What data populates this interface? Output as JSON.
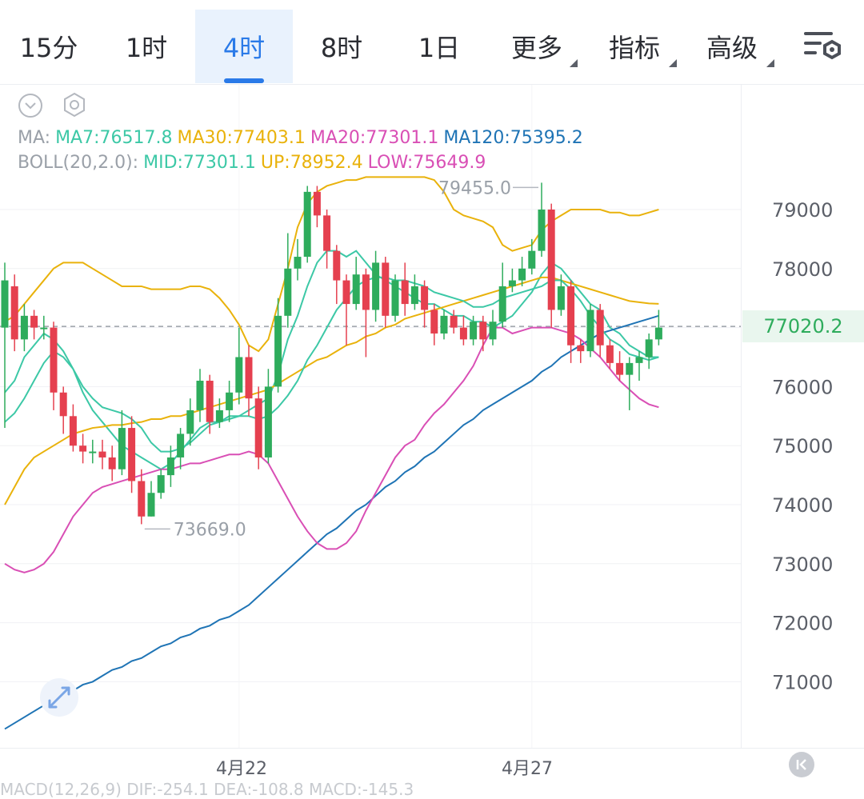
{
  "tabs": [
    {
      "label": "15分",
      "active": false
    },
    {
      "label": "1时",
      "active": false
    },
    {
      "label": "4时",
      "active": true
    },
    {
      "label": "8时",
      "active": false
    },
    {
      "label": "1日",
      "active": false
    },
    {
      "label": "更多",
      "active": false,
      "dropdown": true
    },
    {
      "label": "指标",
      "active": false,
      "dropdown": true
    },
    {
      "label": "高级",
      "active": false,
      "dropdown": true
    }
  ],
  "icons": {
    "settings": "list-settings-icon",
    "collapse": "chevron-down-circle-icon",
    "hexagon": "hexagon-settings-icon",
    "expand": "expand-arrows-icon",
    "go_latest": "skip-to-latest-icon"
  },
  "legend_ma": {
    "prefix": "MA:",
    "items": [
      {
        "text": "MA7:76517.8",
        "color": "#3cc8a6"
      },
      {
        "text": "MA30:77403.1",
        "color": "#e9b20b"
      },
      {
        "text": "MA20:77301.1",
        "color": "#d94fb5"
      },
      {
        "text": "MA120:75395.2",
        "color": "#1f74b5"
      }
    ]
  },
  "legend_boll": {
    "prefix": "BOLL(20,2.0):",
    "items": [
      {
        "text": "MID:77301.1",
        "color": "#3cc8a6"
      },
      {
        "text": "UP:78952.4",
        "color": "#e9b20b"
      },
      {
        "text": "LOW:75649.9",
        "color": "#d94fb5"
      }
    ]
  },
  "current_price": "77020.2",
  "bottom_peek": "MACD(12,26,9) DIF:-254.1 DEA:-108.8 MACD:-145.3",
  "colors": {
    "up": "#2eac5c",
    "down": "#e5404f",
    "accent": "#2a7ae8"
  },
  "chart_data": {
    "type": "candlestick",
    "y_ticks": [
      79000,
      78000,
      77000,
      76000,
      75000,
      74000,
      73000,
      72000,
      71000
    ],
    "y_tick_labels": [
      "79000",
      "78000",
      "",
      "76000",
      "75000",
      "74000",
      "73000",
      "72000",
      "71000"
    ],
    "x_labels": [
      {
        "label": "4月22",
        "index": 24
      },
      {
        "label": "4月27",
        "index": 54
      }
    ],
    "high_marker": {
      "label": "79455.0",
      "value": 79455.0,
      "index": 55
    },
    "low_marker": {
      "label": "73669.0",
      "value": 73669.0,
      "index": 14
    },
    "current": 77020.2,
    "candles": [
      [
        77000,
        77800,
        78100,
        75300
      ],
      [
        77700,
        76800,
        77900,
        76600
      ],
      [
        76800,
        77200,
        77400,
        76600
      ],
      [
        77200,
        77000,
        77300,
        76800
      ],
      [
        77000,
        77000,
        77200,
        76800
      ],
      [
        77000,
        75900,
        77100,
        75600
      ],
      [
        75900,
        75500,
        76000,
        75200
      ],
      [
        75500,
        75000,
        75700,
        74900
      ],
      [
        75000,
        74900,
        75200,
        74700
      ],
      [
        74900,
        74900,
        75100,
        74700
      ],
      [
        74900,
        74800,
        75100,
        74600
      ],
      [
        74800,
        74600,
        75000,
        74400
      ],
      [
        74600,
        75300,
        75600,
        74500
      ],
      [
        75300,
        74400,
        75500,
        74200
      ],
      [
        74400,
        73800,
        74600,
        73669
      ],
      [
        73800,
        74200,
        74400,
        73800
      ],
      [
        74200,
        74500,
        74600,
        74100
      ],
      [
        74500,
        74800,
        75000,
        74300
      ],
      [
        74800,
        75200,
        75300,
        74600
      ],
      [
        75200,
        75600,
        75800,
        75000
      ],
      [
        75600,
        76100,
        76300,
        75400
      ],
      [
        76100,
        75400,
        76200,
        75200
      ],
      [
        75400,
        75600,
        75800,
        75300
      ],
      [
        75600,
        75900,
        76100,
        75400
      ],
      [
        75900,
        76500,
        77000,
        75700
      ],
      [
        76500,
        75800,
        76700,
        75500
      ],
      [
        75800,
        74800,
        76000,
        74600
      ],
      [
        74800,
        76000,
        76300,
        74700
      ],
      [
        76000,
        77200,
        77500,
        75900
      ],
      [
        77200,
        78000,
        78600,
        77000
      ],
      [
        78000,
        78200,
        78500,
        77800
      ],
      [
        78200,
        79300,
        79400,
        78100
      ],
      [
        79300,
        78900,
        79400,
        78700
      ],
      [
        78900,
        78300,
        79000,
        78000
      ],
      [
        78300,
        77800,
        78400,
        77400
      ],
      [
        77800,
        77400,
        77900,
        76700
      ],
      [
        77400,
        77900,
        78200,
        77300
      ],
      [
        77900,
        77300,
        78000,
        76500
      ],
      [
        77300,
        78100,
        78300,
        77100
      ],
      [
        78100,
        77200,
        78200,
        77000
      ],
      [
        77200,
        77800,
        77900,
        77100
      ],
      [
        77800,
        77400,
        78100,
        77200
      ],
      [
        77400,
        77700,
        77900,
        77300
      ],
      [
        77700,
        77300,
        77800,
        77000
      ],
      [
        77300,
        76900,
        77400,
        76700
      ],
      [
        76900,
        77200,
        77300,
        76800
      ],
      [
        77200,
        77000,
        77300,
        76900
      ],
      [
        77000,
        76800,
        77200,
        76700
      ],
      [
        76800,
        77100,
        77200,
        76700
      ],
      [
        77100,
        76800,
        77200,
        76600
      ],
      [
        76800,
        77100,
        77300,
        76700
      ],
      [
        77100,
        77700,
        78100,
        77000
      ],
      [
        77700,
        77800,
        78000,
        77600
      ],
      [
        77800,
        78000,
        78200,
        77700
      ],
      [
        78000,
        78300,
        78500,
        77900
      ],
      [
        78300,
        79000,
        79455,
        78200
      ],
      [
        79000,
        77300,
        79100,
        77000
      ],
      [
        77300,
        77700,
        77900,
        77200
      ],
      [
        77700,
        76700,
        77800,
        76400
      ],
      [
        76700,
        76600,
        76800,
        76400
      ],
      [
        76600,
        77300,
        77400,
        76500
      ],
      [
        77300,
        76700,
        77400,
        76500
      ],
      [
        76700,
        76400,
        76800,
        76300
      ],
      [
        76400,
        76200,
        76600,
        76100
      ],
      [
        76200,
        76400,
        76500,
        75600
      ],
      [
        76400,
        76500,
        76600,
        76100
      ],
      [
        76500,
        76800,
        76900,
        76300
      ],
      [
        76800,
        77000,
        77300,
        76700
      ]
    ],
    "series": [
      {
        "name": "MA7",
        "color": "#3cc8a6",
        "values": [
          75900,
          76100,
          76500,
          76700,
          76900,
          76800,
          76600,
          76300,
          75900,
          75600,
          75400,
          75200,
          75000,
          74900,
          74800,
          74700,
          74600,
          74700,
          74900,
          75100,
          75300,
          75400,
          75400,
          75500,
          75500,
          75600,
          75700,
          75800,
          76200,
          76800,
          77200,
          77700,
          78100,
          78300,
          78300,
          78200,
          78300,
          78100,
          77900,
          77800,
          77700,
          77600,
          77500,
          77400,
          77400,
          77300,
          77200,
          77200,
          77100,
          77100,
          77000,
          77100,
          77200,
          77400,
          77600,
          77900,
          78100,
          78000,
          77800,
          77600,
          77400,
          77300,
          77000,
          76900,
          76700,
          76600,
          76500,
          76500
        ]
      },
      {
        "name": "MA30",
        "color": "#e9b20b",
        "values": [
          74000,
          74300,
          74600,
          74800,
          74900,
          75000,
          75100,
          75200,
          75250,
          75300,
          75320,
          75350,
          75350,
          75380,
          75400,
          75450,
          75450,
          75500,
          75500,
          75550,
          75600,
          75650,
          75700,
          75750,
          75800,
          75850,
          75900,
          75950,
          76050,
          76150,
          76250,
          76350,
          76450,
          76500,
          76600,
          76700,
          76750,
          76850,
          76900,
          77000,
          77050,
          77150,
          77200,
          77250,
          77300,
          77350,
          77400,
          77450,
          77500,
          77550,
          77600,
          77650,
          77700,
          77750,
          77800,
          77850,
          77850,
          77800,
          77750,
          77700,
          77650,
          77600,
          77550,
          77500,
          77450,
          77430,
          77410,
          77403
        ]
      },
      {
        "name": "MA120",
        "color": "#1f74b5",
        "values": [
          70200,
          70300,
          70400,
          70500,
          70600,
          70700,
          70750,
          70850,
          70950,
          71000,
          71100,
          71200,
          71250,
          71350,
          71400,
          71500,
          71600,
          71650,
          71750,
          71800,
          71900,
          71950,
          72050,
          72100,
          72200,
          72300,
          72450,
          72600,
          72750,
          72900,
          73050,
          73200,
          73350,
          73500,
          73600,
          73750,
          73900,
          74000,
          74150,
          74300,
          74400,
          74550,
          74650,
          74800,
          74900,
          75050,
          75200,
          75350,
          75450,
          75600,
          75700,
          75800,
          75900,
          76000,
          76100,
          76250,
          76350,
          76500,
          76600,
          76700,
          76800,
          76900,
          76950,
          77000,
          77050,
          77100,
          77150,
          77200
        ]
      },
      {
        "name": "BOLL-MID",
        "color": "#3cc8a6",
        "values": [
          75400,
          75550,
          75800,
          76100,
          76400,
          76600,
          76500,
          76300,
          76000,
          75800,
          75650,
          75600,
          75550,
          75450,
          75300,
          75050,
          74900,
          74900,
          74950,
          75050,
          75200,
          75350,
          75400,
          75450,
          75500,
          75500,
          75450,
          75500,
          75650,
          75850,
          76100,
          76450,
          76700,
          77000,
          77300,
          77500,
          77700,
          77800,
          77850,
          77850,
          77800,
          77800,
          77750,
          77700,
          77600,
          77550,
          77500,
          77450,
          77350,
          77350,
          77400,
          77500,
          77550,
          77600,
          77650,
          77700,
          77800,
          77800,
          77650,
          77450,
          77200,
          77000,
          76800,
          76700,
          76550,
          76500,
          76450,
          76500
        ]
      },
      {
        "name": "BOLL-UP",
        "color": "#e9b20b",
        "values": [
          77100,
          77200,
          77400,
          77600,
          77800,
          78000,
          78100,
          78100,
          78100,
          78000,
          77900,
          77800,
          77700,
          77700,
          77700,
          77650,
          77650,
          77650,
          77650,
          77700,
          77700,
          77650,
          77500,
          77300,
          77050,
          76700,
          76600,
          76800,
          77400,
          78000,
          78700,
          79100,
          79300,
          79400,
          79450,
          79500,
          79500,
          79550,
          79550,
          79550,
          79550,
          79550,
          79550,
          79550,
          79500,
          79300,
          79000,
          78900,
          78850,
          78800,
          78700,
          78400,
          78300,
          78350,
          78400,
          78650,
          78800,
          78900,
          79000,
          79000,
          79000,
          79000,
          78950,
          78950,
          78900,
          78900,
          78950,
          79000
        ]
      },
      {
        "name": "BOLL-LOW",
        "color": "#d94fb5",
        "values": [
          73000,
          72900,
          72850,
          72900,
          73000,
          73200,
          73500,
          73800,
          74000,
          74200,
          74300,
          74350,
          74400,
          74450,
          74500,
          74550,
          74600,
          74600,
          74650,
          74700,
          74700,
          74750,
          74800,
          74850,
          74850,
          74900,
          74850,
          74700,
          74400,
          74100,
          73800,
          73550,
          73350,
          73250,
          73250,
          73350,
          73550,
          73900,
          74200,
          74500,
          74800,
          75000,
          75100,
          75350,
          75550,
          75700,
          75900,
          76100,
          76350,
          76700,
          77000,
          77000,
          76900,
          76950,
          77000,
          77000,
          77000,
          76950,
          76900,
          76800,
          76650,
          76500,
          76300,
          76100,
          75950,
          75800,
          75700,
          75650
        ]
      }
    ]
  }
}
